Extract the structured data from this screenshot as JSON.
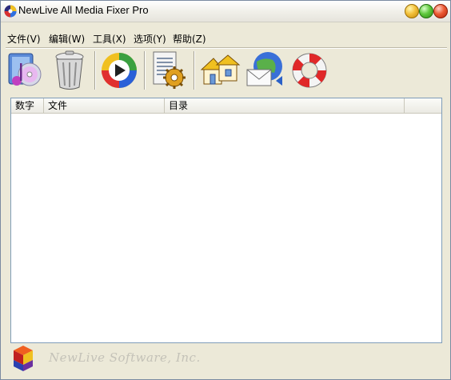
{
  "window": {
    "title": "NewLive All Media Fixer Pro"
  },
  "menu": [
    {
      "label": "文件(V)"
    },
    {
      "label": "编辑(W)"
    },
    {
      "label": "工具(X)"
    },
    {
      "label": "选项(Y)"
    },
    {
      "label": "帮助(Z)"
    }
  ],
  "toolbar": [
    {
      "icon": "add-media-icon"
    },
    {
      "icon": "trash-icon"
    },
    {
      "icon": "media-player-icon"
    },
    {
      "icon": "settings-document-icon"
    },
    {
      "icon": "home-icon"
    },
    {
      "icon": "email-icon"
    },
    {
      "icon": "help-lifebuoy-icon"
    }
  ],
  "list": {
    "columns": [
      "数字",
      "文件",
      "目录",
      ""
    ],
    "rows": []
  },
  "footer": {
    "company": "NewLive Software, Inc."
  },
  "colors": {
    "accent": "#7f9db9",
    "window_bg": "#ece9d8"
  }
}
